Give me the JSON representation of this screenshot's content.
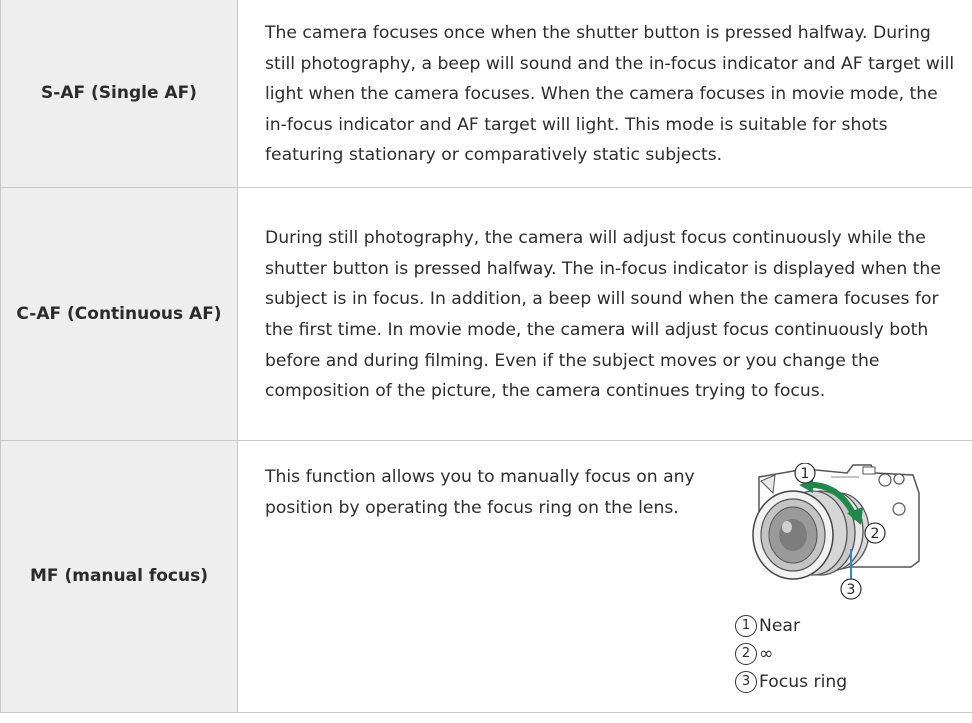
{
  "rows": [
    {
      "mode": "S-AF (Single AF)",
      "description": "The camera focuses once when the shutter button is pressed halfway. During still photography, a beep will sound and the in-focus indicator and AF target will light when the camera focuses. When the camera focuses in movie mode, the in-focus indicator and AF target will light. This mode is suitable for shots featuring stationary or comparatively static subjects."
    },
    {
      "mode": "C-AF (Continuous AF)",
      "description": "During still photography, the camera will adjust focus continuously while the shutter button is pressed halfway. The in-focus indicator is displayed when the subject is in focus. In addition, a beep will sound when the camera focuses for the first time. In movie mode, the camera will adjust focus continuously both before and during filming. Even if the subject moves or you change the composition of the picture, the camera continues trying to focus."
    },
    {
      "mode": "MF (manual focus)",
      "description": "This function allows you to manually focus on any position by operating the focus ring on the lens.",
      "figure": {
        "callouts": [
          "1",
          "2",
          "3"
        ],
        "legend": [
          {
            "num": "1",
            "label": "Near"
          },
          {
            "num": "2",
            "label": "∞"
          },
          {
            "num": "3",
            "label": "Focus ring"
          }
        ]
      }
    }
  ]
}
